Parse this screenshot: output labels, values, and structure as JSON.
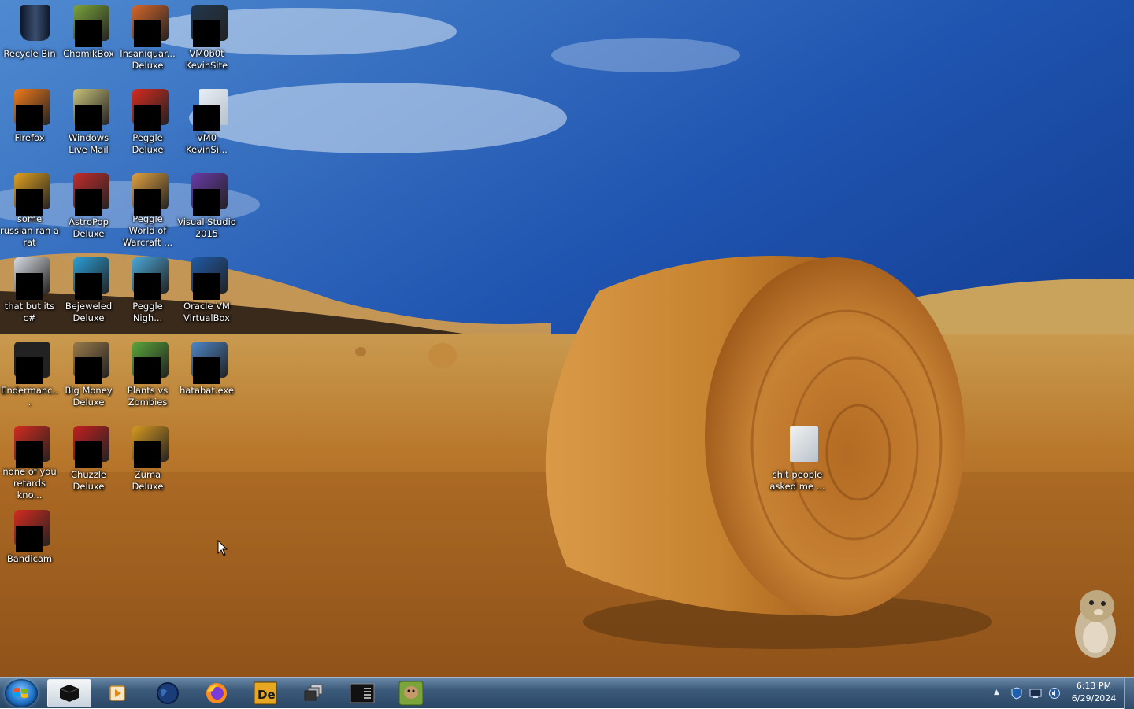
{
  "desktop": {
    "icons": [
      {
        "label": "Recycle Bin",
        "icon": "recycle-bin-icon",
        "color": "#1a2740"
      },
      {
        "label": "ChomikBox",
        "icon": "chomikbox-icon",
        "color": "#7ba43a"
      },
      {
        "label": "Insaniquar... Deluxe",
        "icon": "insaniquarium-icon",
        "color": "#d6672a"
      },
      {
        "label": "VM0b0t KevinSite",
        "icon": "vm-icon",
        "color": "#22384e"
      },
      {
        "label": "Firefox",
        "icon": "firefox-icon",
        "color": "#ef7a1b"
      },
      {
        "label": "Windows Live Mail",
        "icon": "mail-icon",
        "color": "#c9c27a"
      },
      {
        "label": "Peggle Deluxe",
        "icon": "peggle-icon",
        "color": "#d42b1f"
      },
      {
        "label": "VM0 KevinSi...",
        "icon": "document-icon",
        "color": "#e8eef5"
      },
      {
        "label": "some russian ran a rat",
        "icon": "dreamweaver-icon",
        "color": "#e0a020"
      },
      {
        "label": "AstroPop Deluxe",
        "icon": "astropop-icon",
        "color": "#c42c2c"
      },
      {
        "label": "Peggle World of Warcraft ...",
        "icon": "peggle-wow-icon",
        "color": "#e0a040"
      },
      {
        "label": "Visual Studio 2015",
        "icon": "visual-studio-icon",
        "color": "#6a3aa8"
      },
      {
        "label": "that but its c#",
        "icon": "window-stack-icon",
        "color": "#d8dce2"
      },
      {
        "label": "Bejeweled Deluxe",
        "icon": "bejeweled-icon",
        "color": "#2a9fd8"
      },
      {
        "label": "Peggle Nigh...",
        "icon": "peggle-nights-icon",
        "color": "#4aa7d8"
      },
      {
        "label": "Oracle VM VirtualBox",
        "icon": "virtualbox-icon",
        "color": "#1e5aa8"
      },
      {
        "label": "Endermanc...",
        "icon": "console-icon",
        "color": "#222222"
      },
      {
        "label": "Big Money Deluxe",
        "icon": "big-money-icon",
        "color": "#9a7a4a"
      },
      {
        "label": "Plants vs Zombies",
        "icon": "pvz-icon",
        "color": "#5aa63a"
      },
      {
        "label": "hatabat.exe",
        "icon": "hatabat-icon",
        "color": "#4d86c8"
      },
      {
        "label": "none of you retards kno...",
        "icon": "bandicam-icon",
        "color": "#d42b1f"
      },
      {
        "label": "Chuzzle Deluxe",
        "icon": "chuzzle-icon",
        "color": "#c42020"
      },
      {
        "label": "Zuma Deluxe",
        "icon": "zuma-icon",
        "color": "#d89a20"
      },
      {
        "label": "Bandicam",
        "icon": "bandicam-icon",
        "color": "#d42b1f"
      },
      {
        "label": "shit people asked me ...",
        "icon": "document-icon",
        "color": "#f2f2f2"
      }
    ]
  },
  "taskbar": {
    "start_icon": "windows-start-icon",
    "pinned": [
      {
        "name": "virtualbox-vm-icon",
        "active": true
      },
      {
        "name": "media-player-icon",
        "active": false
      },
      {
        "name": "globe-icon",
        "active": false
      },
      {
        "name": "firefox-icon",
        "active": false
      },
      {
        "name": "dreamweaver-icon",
        "active": false
      },
      {
        "name": "window-stack-icon",
        "active": false
      },
      {
        "name": "console-icon",
        "active": false
      },
      {
        "name": "chomikbox-icon",
        "active": false
      }
    ],
    "tray": {
      "time": "6:13 PM",
      "date": "6/29/2024"
    }
  }
}
